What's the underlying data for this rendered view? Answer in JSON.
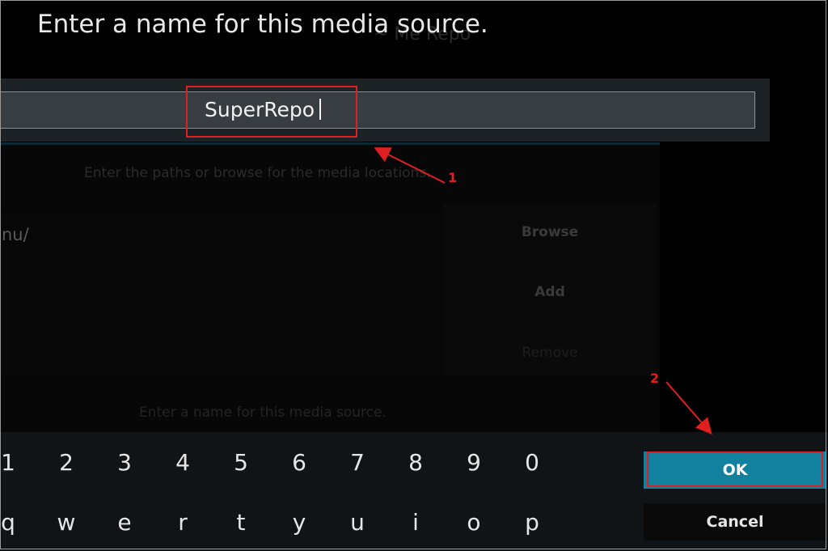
{
  "dialog": {
    "title": "Enter a name for this media source.",
    "input_value": "SuperRepo",
    "ok_label": "OK",
    "cancel_label": "Cancel"
  },
  "background": {
    "title_fragment": "~ Me Repo",
    "instruction": "Enter the paths or browse for the media locations.",
    "path_fragment": "nu/",
    "buttons": [
      "Browse",
      "Add",
      "Remove"
    ],
    "name_label": "Enter a name for this media source."
  },
  "keyboard": {
    "number_row": [
      "1",
      "2",
      "3",
      "4",
      "5",
      "6",
      "7",
      "8",
      "9",
      "0"
    ],
    "letter_row": [
      "q",
      "w",
      "e",
      "r",
      "t",
      "y",
      "u",
      "i",
      "o",
      "p"
    ]
  },
  "annotations": {
    "step1": "1",
    "step2": "2",
    "color": "#e02020"
  },
  "colors": {
    "ok_button": "#12819f",
    "input_bg": "#383d42"
  }
}
